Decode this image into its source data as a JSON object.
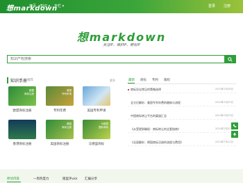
{
  "nav": {
    "logo": "想markdown",
    "home": "首页",
    "knowledge": "知识 ▾",
    "experts": "专栏 ▾",
    "login": "登录",
    "register": "注册"
  },
  "hero": {
    "logo": "想markdown",
    "slogan": "关注IP、保护IP、孵化IP"
  },
  "search": {
    "placeholder": "知识产权搜索"
  },
  "manual": {
    "title": "知识手册",
    "subtitle": "推荐",
    "more": "更多",
    "tiles": [
      {
        "badge": "欧盟\n商标注册",
        "label": "欧盟商标注册"
      },
      {
        "badge": "美国\n专利申请",
        "label": "专利年费"
      },
      {
        "badge": "",
        "label": "美国专利申请"
      },
      {
        "badge": "",
        "label": "香港商标注册"
      },
      {
        "badge": "美国\n商标注册",
        "label": "美国商标注册"
      },
      {
        "badge": "马德里\n国际商标",
        "label": "马德里商标"
      }
    ]
  },
  "news": {
    "tabs": [
      "最新",
      "商标",
      "专利",
      "版权"
    ],
    "items": [
      {
        "title": "商标异议常见的策略选择",
        "date": "2024年7月26日"
      },
      {
        "title": "全方位解析：美国专利年费的缴纳与流程",
        "date": "2024年7月25日"
      },
      {
        "title": "中国商标转让平台的渠道汇总",
        "date": "2024年7月23日"
      },
      {
        "title": "《从受理到确权：商标转让的全套指南》",
        "date": "2024年7月22日"
      },
      {
        "title": "《全面解析：德国商标注册的流程与费用》",
        "date": "2024年7月11日"
      }
    ]
  },
  "footer": {
    "links": [
      "原创内容",
      "一周热度力",
      "版里评ukk",
      "汇编分享"
    ]
  },
  "colors": {
    "brand": "#2f9e3a",
    "accent": "#9cc23a"
  }
}
